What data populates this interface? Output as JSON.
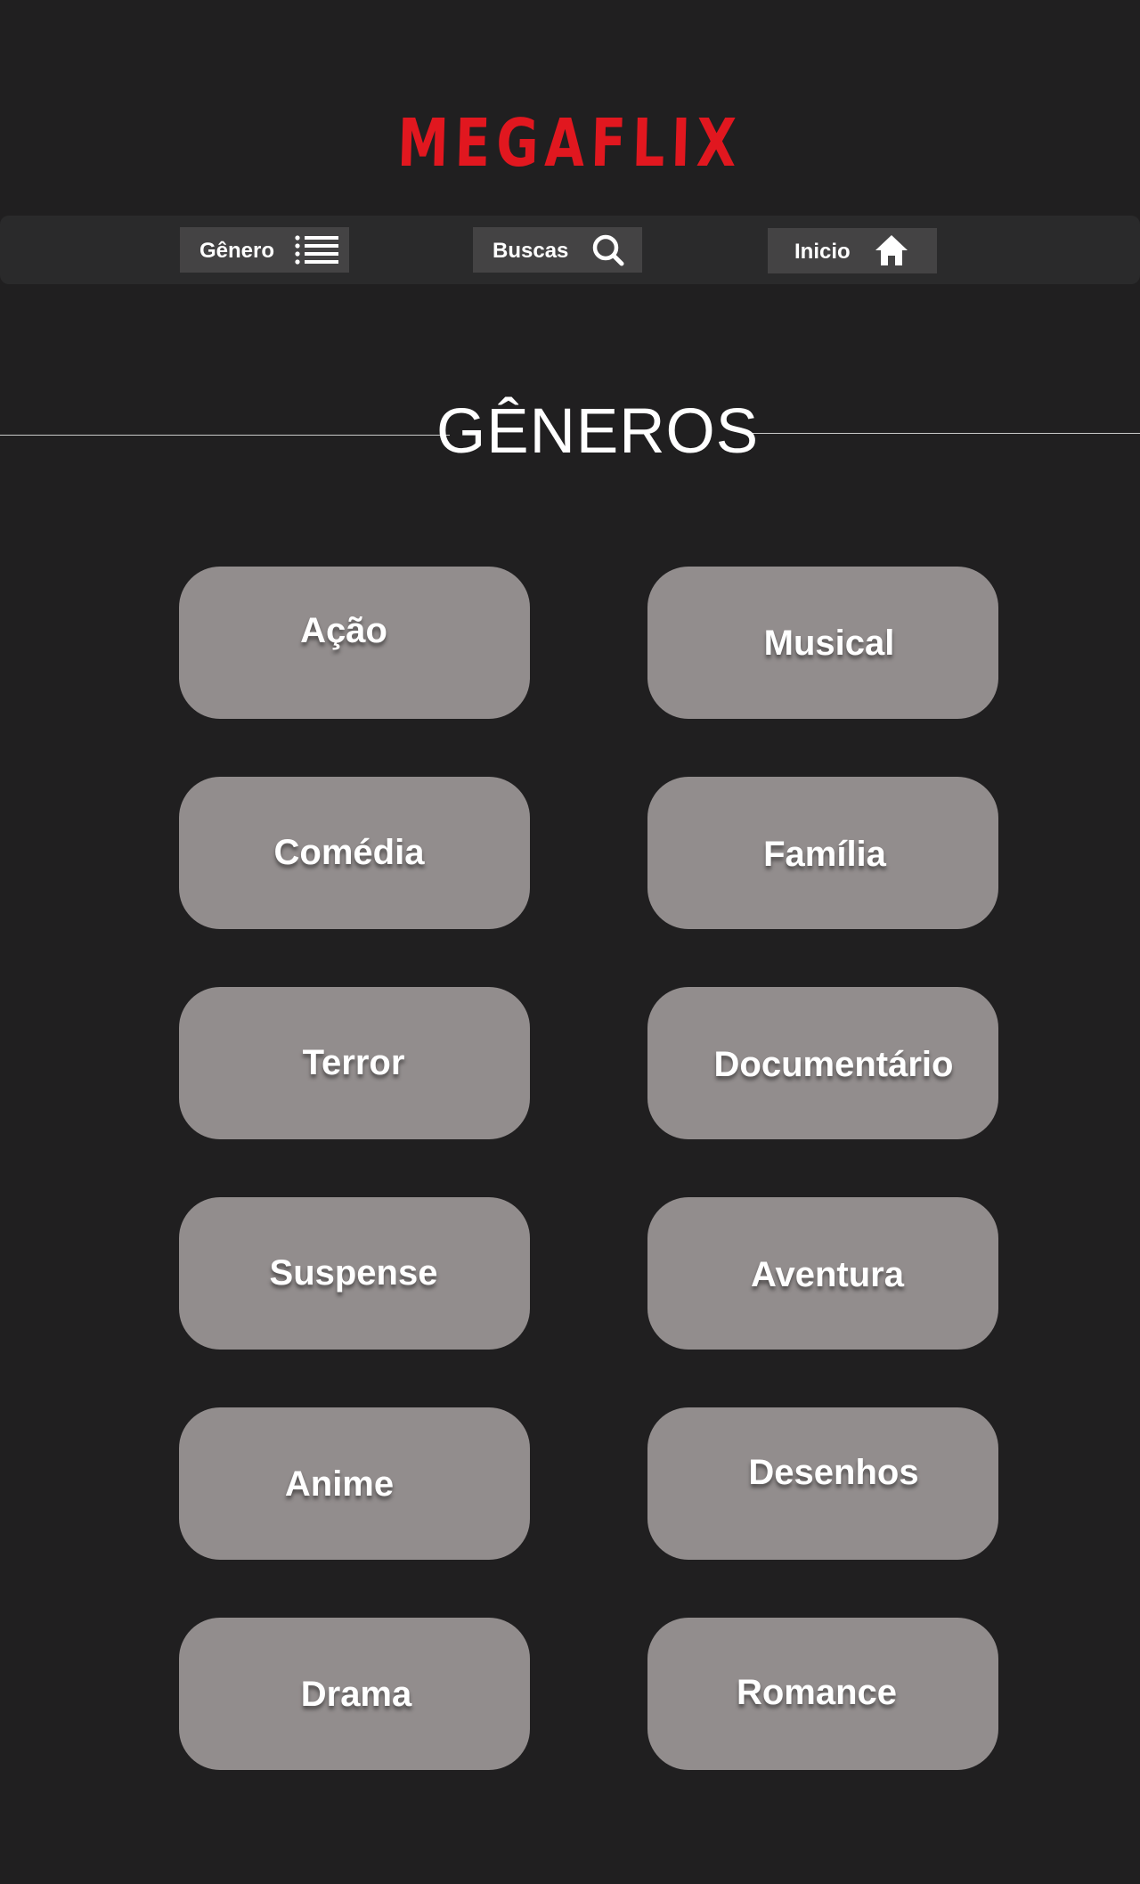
{
  "brand": {
    "logo_text": "MEGAFLIX",
    "accent_color": "#e1171f"
  },
  "nav": {
    "items": [
      {
        "label": "Gênero",
        "icon": "list-icon"
      },
      {
        "label": "Buscas",
        "icon": "search-icon"
      },
      {
        "label": "Inicio",
        "icon": "home-icon"
      }
    ]
  },
  "section": {
    "title": "GÊNEROS"
  },
  "genres": [
    "Ação",
    "Musical",
    "Comédia",
    "Família",
    "Terror",
    "Documentário",
    "Suspense",
    "Aventura",
    "Anime",
    "Desenhos",
    "Drama",
    "Romance"
  ],
  "colors": {
    "background": "#201f20",
    "navbar": "#2a2a2b",
    "nav_button": "#444344",
    "genre_button": "#928d8d",
    "text": "#ffffff"
  }
}
